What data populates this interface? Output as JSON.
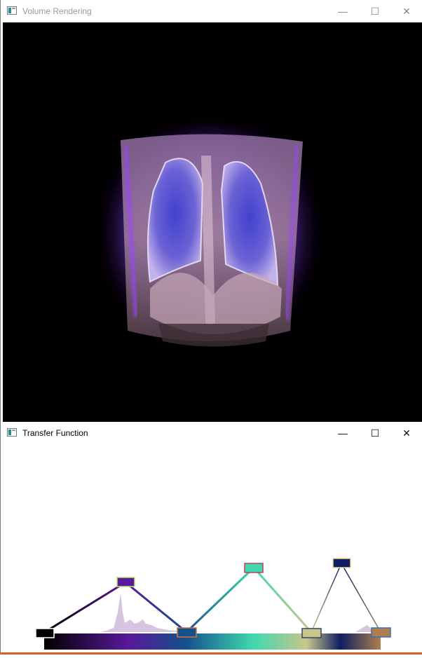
{
  "volume_window": {
    "title": "Volume Rendering",
    "controls": {
      "minimize": "—",
      "maximize": "☐",
      "close": "✕"
    }
  },
  "transfer_window": {
    "title": "Transfer Function",
    "controls": {
      "minimize": "—",
      "maximize": "☐",
      "close": "✕"
    },
    "control_points": [
      {
        "name": "tf-point-1",
        "color": "#000000"
      },
      {
        "name": "tf-point-2",
        "color": "#5a189a"
      },
      {
        "name": "tf-point-3",
        "color": "#14508a"
      },
      {
        "name": "tf-point-4",
        "color": "#3fd8b0"
      },
      {
        "name": "tf-point-5",
        "color": "#c9c68a"
      },
      {
        "name": "tf-point-6",
        "color": "#0e1f62"
      },
      {
        "name": "tf-point-7",
        "color": "#b07e4e"
      }
    ]
  },
  "colors": {
    "viewport_bg": "#000000",
    "volume_glow": "#8a3cf0",
    "histogram": "#c8b0d6"
  },
  "icons": [
    "app-window-icon",
    "minimize-icon",
    "maximize-icon",
    "close-icon"
  ]
}
